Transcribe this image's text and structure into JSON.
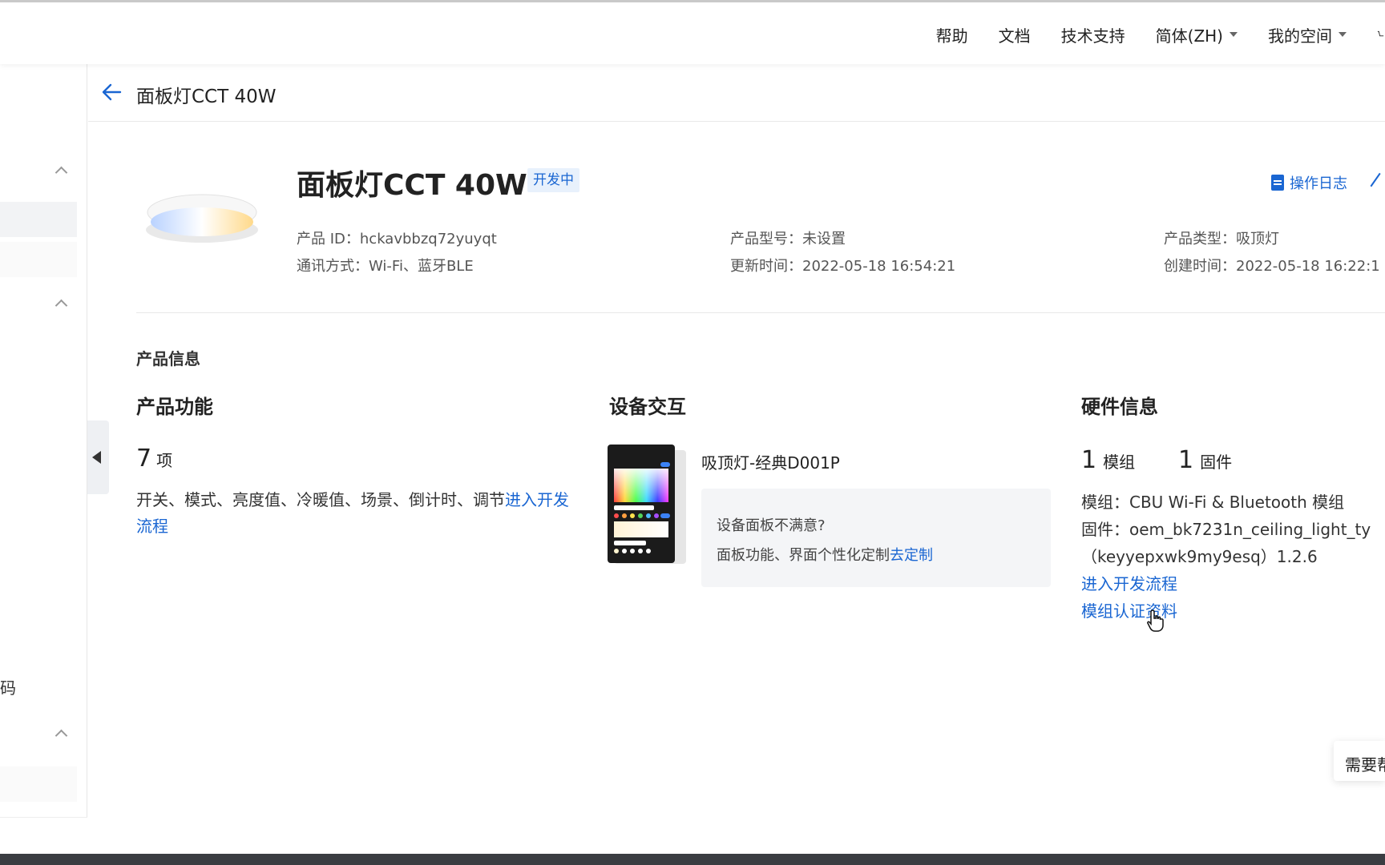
{
  "topnav": {
    "help": "帮助",
    "docs": "文档",
    "support": "技术支持",
    "language": "简体(ZH)",
    "space": "我的空间"
  },
  "sidebar": {
    "partial_text": "码"
  },
  "breadcrumb": {
    "title": "面板灯CCT 40W"
  },
  "product": {
    "name": "面板灯CCT 40W",
    "status": "开发中",
    "log_link": "操作日志",
    "id_label": "产品 ID：",
    "id_value": "hckavbbzq72yuyqt",
    "comm_label": "通讯方式：",
    "comm_value": "Wi-Fi、蓝牙BLE",
    "model_label": "产品型号：",
    "model_value": "未设置",
    "updated_label": "更新时间：",
    "updated_value": "2022-05-18 16:54:21",
    "type_label": "产品类型：",
    "type_value": "吸顶灯",
    "created_label": "创建时间：",
    "created_value": "2022-05-18 16:22:1"
  },
  "info": {
    "section_title": "产品信息",
    "features": {
      "title": "产品功能",
      "count": "7",
      "count_unit": "项",
      "list": "开关、模式、亮度值、冷暖值、场景、倒计时、调节",
      "link": "进入开发流程"
    },
    "interaction": {
      "title": "设备交互",
      "panel_name": "吸顶灯-经典D001P",
      "unsatisfied": "设备面板不满意?",
      "desc": "面板功能、界面个性化定制",
      "customize_link": "去定制"
    },
    "hardware": {
      "title": "硬件信息",
      "module_count": "1",
      "module_unit": "模组",
      "firmware_count": "1",
      "firmware_unit": "固件",
      "module_line": "模组：CBU Wi-Fi & Bluetooth 模组",
      "firmware_line": "固件：oem_bk7231n_ceiling_light_ty",
      "firmware_line2": "（keyyepxwk9my9esq）1.2.6",
      "dev_link": "进入开发流程",
      "cert_link": "模组认证资料"
    }
  },
  "help_float": "需要帮"
}
